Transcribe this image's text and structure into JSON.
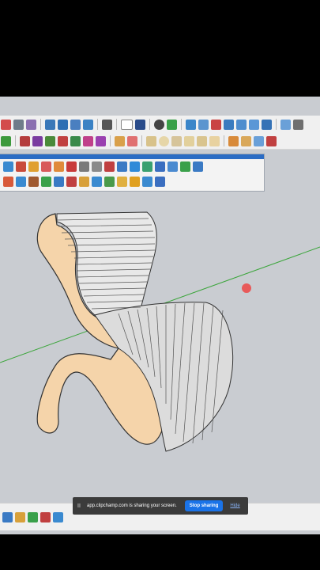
{
  "screen_share": {
    "message": "app.clipchamp.com is sharing your screen.",
    "stop_label": "Stop sharing",
    "hide_label": "Hide",
    "pause_glyph": "II"
  },
  "colors": {
    "background": "#000000",
    "viewport": "#c9ccd1",
    "chair_wood": "#f5d4aa",
    "slat_fill": "#e9e9e9",
    "axis_green": "#3aa53a",
    "cursor_dot": "#e85a5a",
    "share_button": "#1a73e8"
  },
  "icons": {
    "toolbar_row1": [
      "pan-icon",
      "zoom-icon",
      "zoom-window-icon",
      "zoom-extents-icon",
      "style-xray-icon",
      "style-wireframe-icon",
      "style-hidden-line-icon",
      "component-icon",
      "new-icon",
      "user-icon",
      "axes-icon",
      "tape-icon",
      "push-pull-icon",
      "extension-icon",
      "warehouse-icon",
      "layout-icon",
      "section-icon",
      "scenes-icon",
      "copy-icon"
    ],
    "toolbar_row2": [
      "cube-icon",
      "solid-union-icon",
      "solid-subtract-icon",
      "solid-trim-icon",
      "solid-intersect-icon",
      "solid-split-icon",
      "paint-icon",
      "eraser-icon",
      "arc-icon",
      "circle-icon",
      "polygon-icon",
      "offset-icon",
      "follow-me-icon",
      "scale-icon",
      "text-icon",
      "3d-text-icon"
    ],
    "floating_row1": [
      "select-icon",
      "component-browser-icon",
      "paint-bucket-icon",
      "eraser-icon",
      "line-icon",
      "table-icon",
      "flag-icon",
      "pencil-icon",
      "arc-tool-icon",
      "curve-icon",
      "bezier-icon",
      "move-icon",
      "rotate-icon",
      "grid-icon",
      "flask-icon",
      "texture-icon"
    ],
    "floating_row2": [
      "orbit-icon",
      "undo-icon",
      "walk-icon",
      "cut-icon",
      "merge-icon",
      "array-icon",
      "gear-icon",
      "mirror-icon",
      "grid-tile-icon",
      "stamp-icon",
      "solar-icon",
      "sandbox-icon",
      "dots-icon"
    ]
  }
}
